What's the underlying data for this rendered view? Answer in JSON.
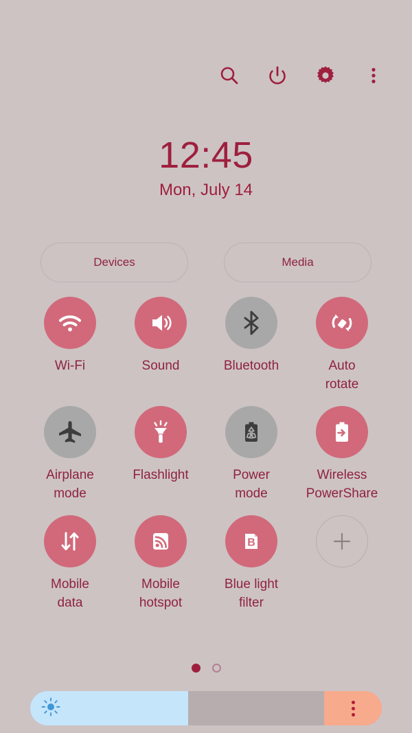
{
  "header": {
    "icons": [
      {
        "name": "search-icon",
        "label": "Search"
      },
      {
        "name": "power-icon",
        "label": "Power off"
      },
      {
        "name": "gear-icon",
        "label": "Settings"
      },
      {
        "name": "more-options-icon",
        "label": "More options"
      }
    ]
  },
  "clock": {
    "time": "12:45",
    "date": "Mon, July 14"
  },
  "pills": {
    "devices_label": "Devices",
    "media_label": "Media"
  },
  "tiles": [
    {
      "label": "Wi-Fi",
      "icon": "wifi-icon",
      "state": "on"
    },
    {
      "label": "Sound",
      "icon": "sound-icon",
      "state": "on"
    },
    {
      "label": "Bluetooth",
      "icon": "bluetooth-icon",
      "state": "off"
    },
    {
      "label": "Auto\nrotate",
      "icon": "auto-rotate-icon",
      "state": "on"
    },
    {
      "label": "Airplane\nmode",
      "icon": "airplane-icon",
      "state": "off"
    },
    {
      "label": "Flashlight",
      "icon": "flashlight-icon",
      "state": "on"
    },
    {
      "label": "Power\nmode",
      "icon": "power-mode-icon",
      "state": "off"
    },
    {
      "label": "Wireless\nPowerShare",
      "icon": "wireless-powershare-icon",
      "state": "on"
    },
    {
      "label": "Mobile\ndata",
      "icon": "mobile-data-icon",
      "state": "on"
    },
    {
      "label": "Mobile\nhotspot",
      "icon": "mobile-hotspot-icon",
      "state": "on"
    },
    {
      "label": "Blue light\nfilter",
      "icon": "blue-light-filter-icon",
      "state": "on"
    },
    {
      "label": "",
      "icon": "add-icon",
      "state": "add"
    }
  ],
  "pagination": {
    "total": 2,
    "current": 1
  },
  "brightness": {
    "icon": "brightness-sun-icon",
    "percent": 45,
    "menu_icon": "more-options-icon"
  },
  "colors": {
    "background": "#cdc3c3",
    "accent": "#9e1f3e",
    "toggle_on": "#d1697a",
    "toggle_off": "#a8a8a8",
    "slider_fill": "#c5e5fb",
    "slider_end": "#f8aa8c",
    "label_text": "#8f2240"
  }
}
